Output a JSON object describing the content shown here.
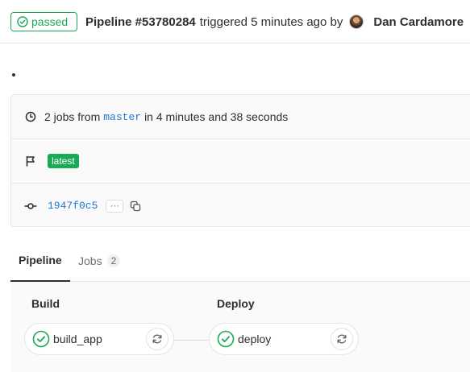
{
  "header": {
    "status": "passed",
    "pipeline_id": "Pipeline #53780284",
    "triggered_text": "triggered 5 minutes ago by",
    "author": "Dan Cardamore"
  },
  "info": {
    "jobs_prefix": "2 jobs from",
    "branch": "master",
    "duration": "in 4 minutes and 38 seconds",
    "latest_badge": "latest",
    "commit_sha": "1947f0c5",
    "ellipsis": "···"
  },
  "tabs": [
    {
      "label": "Pipeline",
      "active": true
    },
    {
      "label": "Jobs",
      "count": "2",
      "active": false
    }
  ],
  "stages": [
    {
      "title": "Build",
      "jobs": [
        {
          "name": "build_app",
          "status": "success"
        }
      ]
    },
    {
      "title": "Deploy",
      "jobs": [
        {
          "name": "deploy",
          "status": "success"
        }
      ]
    }
  ],
  "colors": {
    "success": "#1aaa55",
    "link": "#1f78d1",
    "border": "#e5e5e5"
  }
}
